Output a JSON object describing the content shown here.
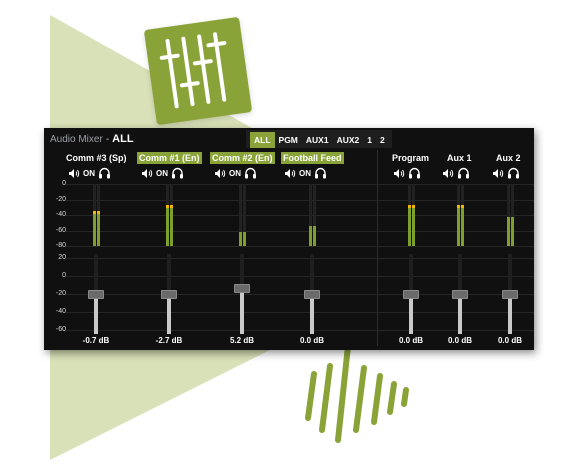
{
  "mixer": {
    "title": "Audio Mixer",
    "separator": "-",
    "current_filter": "ALL"
  },
  "filter_tabs": [
    {
      "label": "ALL",
      "active": true
    },
    {
      "label": "PGM",
      "active": false
    },
    {
      "label": "AUX1",
      "active": false
    },
    {
      "label": "AUX2",
      "active": false
    },
    {
      "label": "1",
      "active": false
    },
    {
      "label": "2",
      "active": false
    }
  ],
  "meter_scale": [
    "0",
    "-20",
    "-40",
    "-60",
    "-80"
  ],
  "fader_scale": [
    "20",
    "0",
    "-20",
    "-40",
    "-60"
  ],
  "on_label": "ON",
  "inputs": [
    {
      "name": "Comm #3 (Sp)",
      "selected": false,
      "level_l": 0.52,
      "level_r": 0.52,
      "peak": true,
      "fader": 0.5,
      "db": "-0.7 dB"
    },
    {
      "name": "Comm #1 (En)",
      "selected": true,
      "level_l": 0.62,
      "level_r": 0.62,
      "peak": true,
      "fader": 0.5,
      "db": "-2.7 dB"
    },
    {
      "name": "Comm #2 (En)",
      "selected": true,
      "level_l": 0.22,
      "level_r": 0.22,
      "peak": false,
      "fader": 0.58,
      "db": "5.2 dB"
    },
    {
      "name": "Football Feed",
      "selected": true,
      "level_l": 0.33,
      "level_r": 0.33,
      "peak": false,
      "fader": 0.5,
      "db": "0.0 dB"
    }
  ],
  "outputs": [
    {
      "name": "Program",
      "level_l": 0.62,
      "level_r": 0.62,
      "peak": true,
      "fader": 0.5,
      "db": "0.0 dB"
    },
    {
      "name": "Aux 1",
      "level_l": 0.62,
      "level_r": 0.62,
      "peak": true,
      "fader": 0.5,
      "db": "0.0 dB"
    },
    {
      "name": "Aux 2",
      "level_l": 0.47,
      "level_r": 0.47,
      "peak": false,
      "fader": 0.5,
      "db": "0.0 dB"
    }
  ],
  "colors": {
    "accent": "#8aa338",
    "meter": "#7f9f2d",
    "peak": "#f2b705",
    "panel": "#101010"
  },
  "icons": [
    "sliders-icon",
    "sound-wave-icon",
    "speaker-icon",
    "headphones-icon"
  ]
}
